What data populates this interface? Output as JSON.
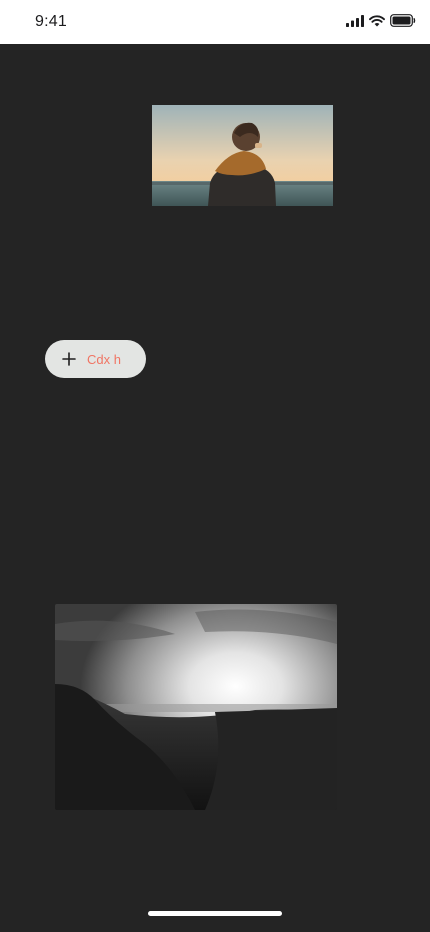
{
  "status_bar": {
    "time": "9:41",
    "signal_icon": "cellular-signal-icon",
    "wifi_icon": "wifi-icon",
    "battery_icon": "battery-icon"
  },
  "photos": [
    {
      "description_icon": "photo-person-scarf-sea"
    },
    {
      "description_icon": "photo-bw-sunlit-field"
    }
  ],
  "action_chip": {
    "icon": "plus-icon",
    "label": "Cdx h",
    "label_color": "#f07564",
    "background": "#e3e5e3"
  },
  "colors": {
    "background": "#242424",
    "status_bar": "#ffffff"
  }
}
